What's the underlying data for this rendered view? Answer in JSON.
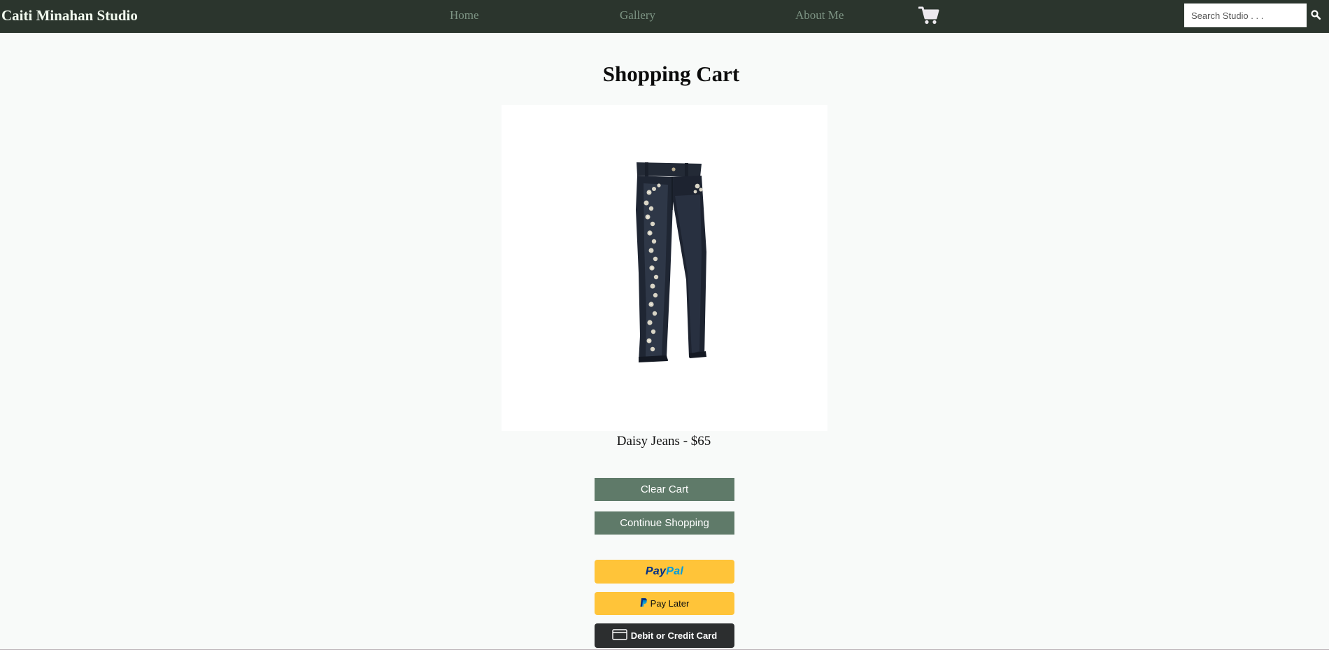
{
  "navbar": {
    "brand": "Caiti Minahan Studio",
    "links": [
      "Home",
      "Gallery",
      "About Me"
    ],
    "search_placeholder": "Search Studio . . .",
    "search_value": ""
  },
  "main": {
    "title": "Shopping Cart",
    "product_caption": "Daisy Jeans - $65",
    "clear_cart_label": "Clear Cart",
    "continue_shopping_label": "Continue Shopping"
  },
  "payment": {
    "paypal_part1": "Pay",
    "paypal_part2": "Pal",
    "pay_later_label": "Pay Later",
    "card_label": "Debit or Credit Card"
  },
  "icons": {
    "cart": "shopping-cart-icon",
    "search": "search-icon",
    "paypal": "paypal-p-icon",
    "card": "credit-card-icon"
  },
  "colors": {
    "navbar_bg": "#2b352d",
    "brand_text": "#f2fbef",
    "nav_link": "#7d9484",
    "cart_icon": "#ece9ee",
    "page_bg": "#f8faf9",
    "button_green": "#5f7a69",
    "paypal_yellow": "#ffc439",
    "paypal_dark_blue": "#003087",
    "paypal_light_blue": "#009cde",
    "card_button_bg": "#2c2e2f"
  }
}
